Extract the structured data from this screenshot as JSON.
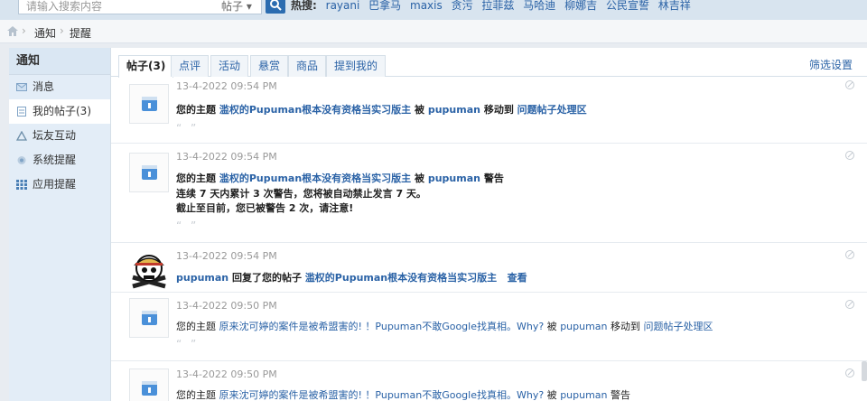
{
  "search": {
    "placeholder": "请输入搜索内容",
    "category": "帖子 ▾"
  },
  "hot": {
    "label": "热搜:",
    "terms": [
      "rayani",
      "巴拿马",
      "maxis",
      "贪污",
      "拉菲兹",
      "马哈迪",
      "柳娜吉",
      "公民宣誓",
      "林吉祥"
    ]
  },
  "breadcrumb": [
    "通知",
    "提醒"
  ],
  "sidebar": {
    "title": "通知",
    "items": [
      {
        "label": "消息",
        "icon": "envelope-icon"
      },
      {
        "label": "我的帖子(3)",
        "icon": "document-icon",
        "active": true
      },
      {
        "label": "坛友互动",
        "icon": "triangle-icon"
      },
      {
        "label": "系统提醒",
        "icon": "gear-icon"
      },
      {
        "label": "应用提醒",
        "icon": "grid-icon"
      }
    ]
  },
  "tabs": [
    "帖子(3)",
    "点评",
    "活动",
    "悬赏",
    "商品",
    "提到我的"
  ],
  "filter_label": "筛选设置",
  "notices": [
    {
      "time": "13-4-2022 09:54 PM",
      "p1": "您的主题 ",
      "link": "滥权的Pupuman根本没有资格当实习版主",
      "p2": " 被 ",
      "user": "pupuman",
      "p3": " 移动到 ",
      "target": "问题帖子处理区",
      "quote": "“ ”"
    },
    {
      "time": "13-4-2022 09:54 PM",
      "p1": "您的主题 ",
      "link": "滥权的Pupuman根本没有资格当实习版主",
      "p2": " 被 ",
      "user": "pupuman",
      "p3": " 警告",
      "line2": "连续 7 天内累计 3 次警告，您将被自动禁止发言 7 天。",
      "line3": "截止至目前，您已被警告 2 次，请注意!",
      "quote": "“ ”"
    },
    {
      "time": "13-4-2022 09:54 PM",
      "user": "pupuman",
      "p1": " 回复了您的帖子 ",
      "link": "滥权的Pupuman根本没有资格当实习版主",
      "view": "查看"
    },
    {
      "time": "13-4-2022 09:50 PM",
      "p1": "您的主题 ",
      "link": "原来沈可婷的案件是被希盟害的! ！Pupuman不敢Google找真相。Why?",
      "p2": " 被 ",
      "user": "pupuman",
      "p3": " 移动到 ",
      "target": "问题帖子处理区",
      "quote": "“ ”"
    },
    {
      "time": "13-4-2022 09:50 PM",
      "p1": "您的主题 ",
      "link": "原来沈可婷的案件是被希盟害的! ！Pupuman不敢Google找真相。Why?",
      "p2": " 被 ",
      "user": "pupuman",
      "p3": " 警告"
    }
  ]
}
